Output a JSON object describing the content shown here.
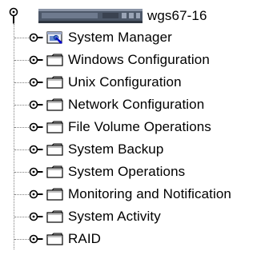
{
  "tree": {
    "root": {
      "label": "wgs67-16",
      "handle_icon": "collapse-handle-icon",
      "icon": "server-icon"
    },
    "items": [
      {
        "label": "System Manager",
        "icon": "system-manager-icon"
      },
      {
        "label": "Windows Configuration",
        "icon": "folder-icon"
      },
      {
        "label": "Unix Configuration",
        "icon": "folder-icon"
      },
      {
        "label": "Network Configuration",
        "icon": "folder-icon"
      },
      {
        "label": "File Volume Operations",
        "icon": "folder-icon"
      },
      {
        "label": "System Backup",
        "icon": "folder-icon"
      },
      {
        "label": "System Operations",
        "icon": "folder-icon"
      },
      {
        "label": "Monitoring and Notification",
        "icon": "folder-icon"
      },
      {
        "label": "System Activity",
        "icon": "folder-icon"
      },
      {
        "label": "RAID",
        "icon": "folder-icon"
      }
    ]
  },
  "colors": {
    "folder_tab": "#c0c0c0",
    "folder_outline": "#000000",
    "server_body": "#5a6678",
    "system_manager_accent": "#0000cc",
    "tree_line": "#808080"
  }
}
